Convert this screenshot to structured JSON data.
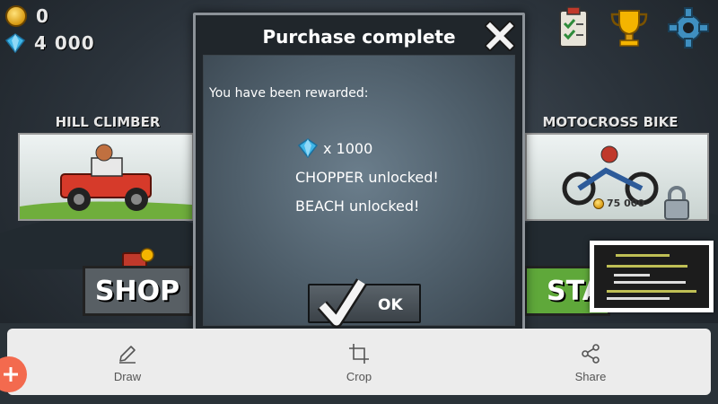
{
  "currency": {
    "coins": "0",
    "gems": "4 000"
  },
  "icons": {
    "missions": "clipboard-icon",
    "trophy": "trophy-icon",
    "settings": "gear-icon"
  },
  "vehicles": {
    "left": {
      "name": "HILL CLIMBER"
    },
    "right": {
      "name": "MOTOCROSS BIKE",
      "price": "75 000"
    }
  },
  "buttons": {
    "shop": "SHOP",
    "start": "STA"
  },
  "modal": {
    "title": "Purchase complete",
    "intro": "You have been rewarded:",
    "gem_reward": "x 1000",
    "unlock_1": "CHOPPER unlocked!",
    "unlock_2": "BEACH unlocked!",
    "ok": "OK"
  },
  "toolbar": {
    "draw": "Draw",
    "crop": "Crop",
    "share": "Share"
  },
  "colors": {
    "modal_bg": "#20262b",
    "shop_green": "#5fa83a",
    "toolbar_bg": "#ececec",
    "fab": "#f36a4e"
  }
}
